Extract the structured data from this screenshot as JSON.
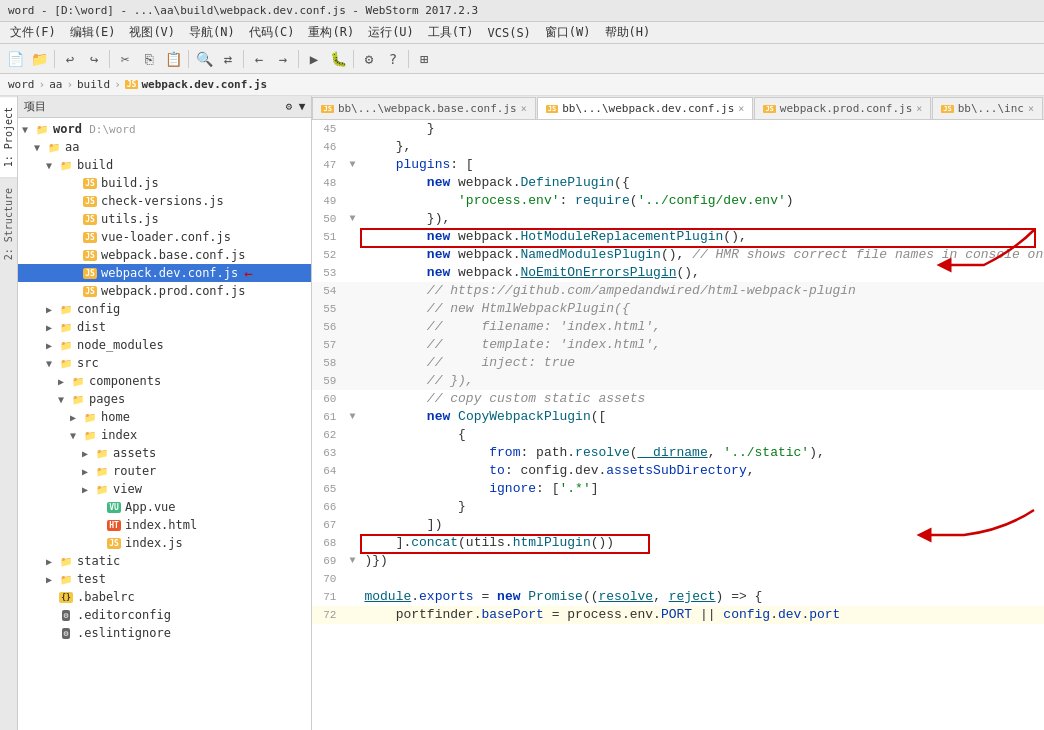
{
  "titleBar": {
    "text": "word - [D:\\word] - ...\\aa\\build\\webpack.dev.conf.js - WebStorm 2017.2.3"
  },
  "menuBar": {
    "items": [
      "文件(F)",
      "编辑(E)",
      "视图(V)",
      "导航(N)",
      "代码(C)",
      "重构(R)",
      "运行(U)",
      "工具(T)",
      "VCS(S)",
      "窗口(W)",
      "帮助(H)"
    ]
  },
  "breadcrumb": {
    "items": [
      "word",
      "aa",
      "build",
      "webpack.dev.conf.js"
    ]
  },
  "projectPanel": {
    "header": "项目",
    "headerRight": "✦"
  },
  "tabs": [
    {
      "label": "bb\\...\\webpack.base.conf.js",
      "active": false,
      "icon": "js"
    },
    {
      "label": "bb\\...\\webpack.dev.conf.js",
      "active": true,
      "icon": "js"
    },
    {
      "label": "webpack.prod.conf.js",
      "active": false,
      "icon": "js"
    },
    {
      "label": "bb\\...\\inc",
      "active": false,
      "icon": "js"
    }
  ],
  "tree": {
    "items": [
      {
        "id": "word",
        "label": "word",
        "sublabel": "D:\\word",
        "type": "root",
        "indent": 0,
        "expanded": true
      },
      {
        "id": "aa",
        "label": "aa",
        "type": "folder",
        "indent": 1,
        "expanded": true
      },
      {
        "id": "build",
        "label": "build",
        "type": "folder-blue",
        "indent": 2,
        "expanded": true
      },
      {
        "id": "build.js",
        "label": "build.js",
        "type": "js",
        "indent": 3
      },
      {
        "id": "check-versions.js",
        "label": "check-versions.js",
        "type": "js",
        "indent": 3
      },
      {
        "id": "utils.js",
        "label": "utils.js",
        "type": "js",
        "indent": 3
      },
      {
        "id": "vue-loader.conf.js",
        "label": "vue-loader.conf.js",
        "type": "js",
        "indent": 3
      },
      {
        "id": "webpack.base.conf.js",
        "label": "webpack.base.conf.js",
        "type": "js",
        "indent": 3
      },
      {
        "id": "webpack.dev.conf.js",
        "label": "webpack.dev.conf.js",
        "type": "js",
        "indent": 3,
        "selected": true
      },
      {
        "id": "webpack.prod.conf.js",
        "label": "webpack.prod.conf.js",
        "type": "js",
        "indent": 3
      },
      {
        "id": "config",
        "label": "config",
        "type": "folder",
        "indent": 2,
        "collapsed": true
      },
      {
        "id": "dist",
        "label": "dist",
        "type": "folder",
        "indent": 2,
        "collapsed": true
      },
      {
        "id": "node_modules",
        "label": "node_modules",
        "type": "folder-yellow",
        "indent": 2,
        "collapsed": true
      },
      {
        "id": "src",
        "label": "src",
        "type": "folder",
        "indent": 2,
        "expanded": true
      },
      {
        "id": "components",
        "label": "components",
        "type": "folder",
        "indent": 3,
        "collapsed": true
      },
      {
        "id": "pages",
        "label": "pages",
        "type": "folder",
        "indent": 3,
        "expanded": true
      },
      {
        "id": "home",
        "label": "home",
        "type": "folder",
        "indent": 4,
        "collapsed": true
      },
      {
        "id": "index",
        "label": "index",
        "type": "folder",
        "indent": 4,
        "expanded": true
      },
      {
        "id": "assets",
        "label": "assets",
        "type": "folder",
        "indent": 5,
        "collapsed": true
      },
      {
        "id": "router",
        "label": "router",
        "type": "folder",
        "indent": 5,
        "collapsed": true
      },
      {
        "id": "view",
        "label": "view",
        "type": "folder",
        "indent": 5,
        "collapsed": true
      },
      {
        "id": "App.vue",
        "label": "App.vue",
        "type": "vue",
        "indent": 5
      },
      {
        "id": "index.html",
        "label": "index.html",
        "type": "html",
        "indent": 5
      },
      {
        "id": "index.js",
        "label": "index.js",
        "type": "js",
        "indent": 5
      },
      {
        "id": "static",
        "label": "static",
        "type": "folder",
        "indent": 2,
        "collapsed": true
      },
      {
        "id": "test",
        "label": "test",
        "type": "folder",
        "indent": 2,
        "collapsed": true
      },
      {
        "id": ".babelrc",
        "label": ".babelrc",
        "type": "json",
        "indent": 2
      },
      {
        "id": ".editorconfig",
        "label": ".editorconfig",
        "type": "rc",
        "indent": 2
      },
      {
        "id": ".eslintignore",
        "label": ".eslintignore",
        "type": "rc",
        "indent": 2
      }
    ]
  },
  "codeLines": [
    {
      "num": 45,
      "fold": "",
      "text": "        }"
    },
    {
      "num": 46,
      "fold": "",
      "text": "    },"
    },
    {
      "num": 47,
      "fold": "▼",
      "text": "    plugins: ["
    },
    {
      "num": 48,
      "fold": "",
      "text": "        new webpack.DefinePlugin({"
    },
    {
      "num": 49,
      "fold": "",
      "text": "            'process.env': require('../config/dev.env')"
    },
    {
      "num": 50,
      "fold": "",
      "text": "        }),"
    },
    {
      "num": 51,
      "fold": "",
      "text": "        new webpack.HotModuleReplacementPlugin(),"
    },
    {
      "num": 52,
      "fold": "",
      "text": "        new webpack.NamedModulesPlugin(), // HMR shows correct file names in console on"
    },
    {
      "num": 53,
      "fold": "",
      "text": "        new webpack.NoEmitOnErrorsPlugin(),",
      "commented": false,
      "box": true
    },
    {
      "num": 54,
      "fold": "",
      "text": "        // https://github.com/ampedandwired/html-webpack-plugin",
      "commented": true
    },
    {
      "num": 55,
      "fold": "",
      "text": "        // new HtmlWebpackPlugin({",
      "commented": true
    },
    {
      "num": 56,
      "fold": "",
      "text": "        //     filename: 'index.html',",
      "commented": true
    },
    {
      "num": 57,
      "fold": "",
      "text": "        //     template: 'index.html',",
      "commented": true
    },
    {
      "num": 58,
      "fold": "",
      "text": "        //     inject: true",
      "commented": true
    },
    {
      "num": 59,
      "fold": "",
      "text": "        // }),",
      "commented": true
    },
    {
      "num": 60,
      "fold": "",
      "text": "        // copy custom static assets"
    },
    {
      "num": 61,
      "fold": "▼",
      "text": "        new CopyWebpackPlugin(["
    },
    {
      "num": 62,
      "fold": "",
      "text": "            {"
    },
    {
      "num": 63,
      "fold": "",
      "text": "                from: path.resolve(__dirname, '../static'),"
    },
    {
      "num": 64,
      "fold": "",
      "text": "                to: config.dev.assetsSubDirectory,"
    },
    {
      "num": 65,
      "fold": "",
      "text": "                ignore: ['.*']"
    },
    {
      "num": 66,
      "fold": "",
      "text": "            }"
    },
    {
      "num": 67,
      "fold": "",
      "text": "        ])"
    },
    {
      "num": 68,
      "fold": "",
      "text": "    ].concat(utils.htmlPlugin())",
      "boxEnd": true
    },
    {
      "num": 69,
      "fold": "▼",
      "text": "))}"
    },
    {
      "num": 70,
      "fold": "",
      "text": ""
    },
    {
      "num": 71,
      "fold": "",
      "text": "module.exports = new Promise((resolve, reject) => {"
    },
    {
      "num": 72,
      "fold": "",
      "text": "    portfinder.basePort = process.env.PORT || config.dev.port",
      "highlight": true
    }
  ],
  "vertTabs": [
    {
      "label": "1: Project"
    },
    {
      "label": "2: Structure"
    }
  ]
}
